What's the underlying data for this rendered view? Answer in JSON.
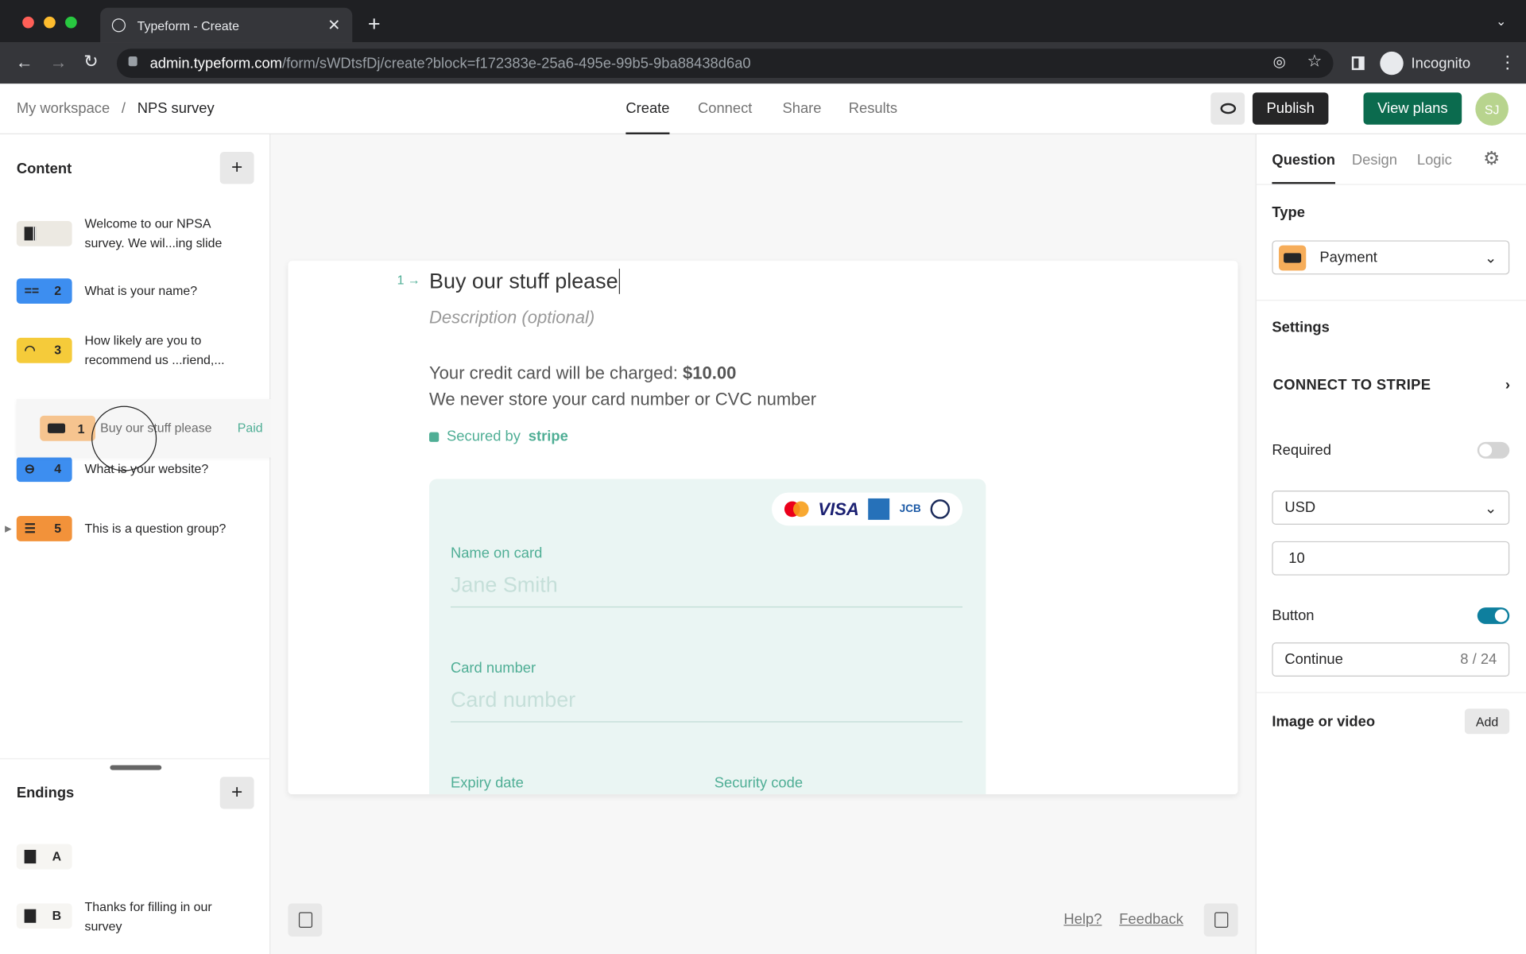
{
  "browser": {
    "tab_title": "Typeform - Create",
    "url_host": "admin.typeform.com",
    "url_path": "/form/sWDtsfDj/create?block=f172383e-25a6-495e-99b5-9ba88438d6a0",
    "incognito": "Incognito"
  },
  "header": {
    "breadcrumb_root": "My workspace",
    "breadcrumb_sep": "/",
    "form_name": "NPS survey",
    "tabs": [
      "Create",
      "Connect",
      "Share",
      "Results"
    ],
    "active_tab": "Create",
    "publish": "Publish",
    "view_plans": "View plans",
    "avatar": "SJ"
  },
  "sidebar": {
    "content_title": "Content",
    "items": [
      {
        "num": "",
        "text": "Welcome to our NPSA survey. We wil...ing slide",
        "color": "#ece9e2"
      },
      {
        "num": "2",
        "text": "What is your name?",
        "color": "#3d8ef0"
      },
      {
        "num": "3",
        "text": "How likely are you to recommend us ...riend,...",
        "color": "#f5cb3a"
      },
      {
        "num": "4",
        "text": "What is your website?",
        "color": "#3d8ef0"
      },
      {
        "num": "5",
        "text": "This is a question group?",
        "color": "#f2923a"
      }
    ],
    "dragging": {
      "num": "1",
      "text": "Buy our stuff please",
      "tag": "Paid",
      "color": "#f6c48f"
    },
    "endings_title": "Endings",
    "endings": [
      {
        "num": "A",
        "text": ""
      },
      {
        "num": "B",
        "text": "Thanks for filling in our survey"
      }
    ]
  },
  "question": {
    "number": "1",
    "title": "Buy our stuff please",
    "description_placeholder": "Description (optional)",
    "charge_text": "Your credit card will be charged:",
    "charge_amount": "$10.00",
    "store_note": "We never store your card number or CVC number",
    "secured_by": "Secured by",
    "stripe": "stripe",
    "card_brands": [
      "mastercard",
      "VISA",
      "amex",
      "JCB",
      "diners"
    ],
    "fields": {
      "name_label": "Name on card",
      "name_placeholder": "Jane Smith",
      "card_label": "Card number",
      "card_placeholder": "Card number",
      "expiry_label": "Expiry date",
      "security_label": "Security code"
    }
  },
  "footer": {
    "help": "Help?",
    "feedback": "Feedback"
  },
  "panel": {
    "tabs": [
      "Question",
      "Design",
      "Logic"
    ],
    "active_tab": "Question",
    "type_label": "Type",
    "type_value": "Payment",
    "settings_label": "Settings",
    "connect_stripe": "CONNECT TO STRIPE",
    "required_label": "Required",
    "required_on": false,
    "currency": "USD",
    "amount": "10",
    "button_label": "Button",
    "button_on": true,
    "button_text": "Continue",
    "button_count": "8 / 24",
    "media_label": "Image or video",
    "media_add": "Add"
  },
  "colors": {
    "accent_green": "#0b6b4e",
    "teal": "#4fae95",
    "toggle_on": "#0e7f9e"
  }
}
